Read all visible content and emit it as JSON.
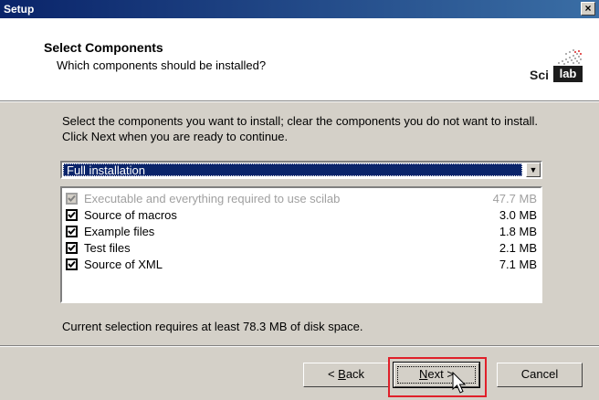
{
  "window": {
    "title": "Setup",
    "close_glyph": "×"
  },
  "header": {
    "title": "Select Components",
    "subtitle": "Which components should be installed?",
    "logo": {
      "part1": "Sci",
      "part2": "lab"
    }
  },
  "intro": "Select the components you want to install; clear the components you do not want to install. Click Next when you are ready to continue.",
  "install_type": {
    "selected": "Full installation",
    "arrow_glyph": "▼"
  },
  "components": [
    {
      "label": "Executable and everything required to use scilab",
      "size": "47.7 MB",
      "checked": true,
      "enabled": false
    },
    {
      "label": "Source of macros",
      "size": "3.0 MB",
      "checked": true,
      "enabled": true
    },
    {
      "label": "Example files",
      "size": "1.8 MB",
      "checked": true,
      "enabled": true
    },
    {
      "label": "Test files",
      "size": "2.1 MB",
      "checked": true,
      "enabled": true
    },
    {
      "label": "Source of XML",
      "size": "7.1 MB",
      "checked": true,
      "enabled": true
    }
  ],
  "disk_requirement": "Current selection requires at least 78.3 MB of disk space.",
  "buttons": {
    "back": {
      "prefix": "< ",
      "accel": "B",
      "rest": "ack"
    },
    "next": {
      "accel": "N",
      "rest": "ext >"
    },
    "cancel": "Cancel"
  },
  "colors": {
    "title_bar": "#0a246a",
    "highlight_box": "#e0202a",
    "selection": "#0a246a"
  }
}
